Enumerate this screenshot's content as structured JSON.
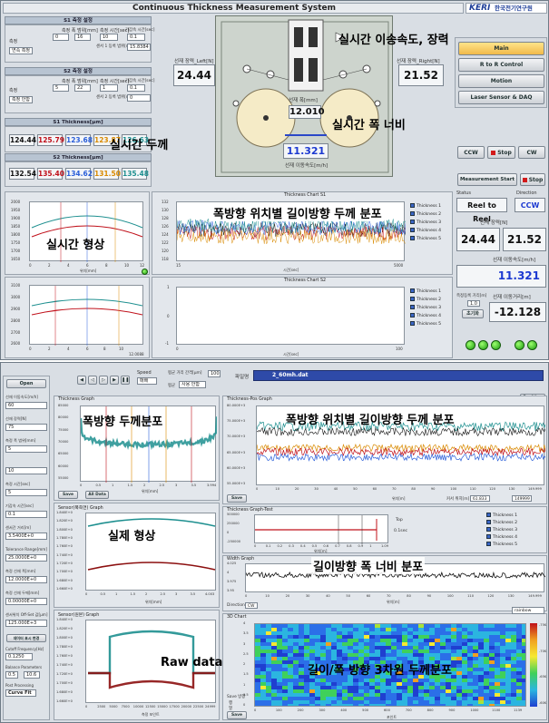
{
  "top": {
    "window_title": "Continuous Thickness Measurement System",
    "logo_brand": "KERI",
    "logo_org": "한국전기연구원",
    "s1_header": "S1 측정 설정",
    "s2_header": "S2 측정 설정",
    "s1_measure_label": "측정",
    "s1_mode": "연속 측정",
    "s1_width_label": "측정 폭 범위[mm]",
    "s1_width_from": "0",
    "s1_width_to": "16",
    "s1_time_label": "측정 시간[sec]",
    "s1_time": "10",
    "s1_wait_label": "기갑속 시간[sec]",
    "s1_wait": "0.1",
    "s1_sensor_label": "센서 1 등록 범위[m]",
    "s1_sensor_value": "15.8384",
    "s2_measure_label": "측정",
    "s2_mode": "측정 안함",
    "s2_width_label": "측정 폭 범위[mm]",
    "s2_width_from": "5",
    "s2_width_to": "22",
    "s2_time_label": "측정 시간[sec]",
    "s2_time": "1",
    "s2_wait_label": "기갑속 시간[sec]",
    "s2_wait": "0.1",
    "s2_sensor_label": "센서 2 등록 범위[m]",
    "s2_sensor_value": "0",
    "s1_thickness_header": "S1 Thickness[μm]",
    "s2_thickness_header": "S2 Thickness[μm]",
    "s1_thickness": [
      "124.44",
      "125.79",
      "123.68",
      "123.87",
      "126.63"
    ],
    "s2_thickness": [
      "132.54",
      "135.40",
      "134.62",
      "131.50",
      "135.48"
    ],
    "thickness_colors": [
      "#111111",
      "#c0101a",
      "#2b5fd9",
      "#d98a00",
      "#1d8f8f"
    ],
    "tension_left_label": "선재 장력_Left[N]",
    "tension_left": "24.44",
    "tension_right_label": "선재 장력_Right[N]",
    "tension_right": "21.52",
    "width_label": "선재 폭[mm]",
    "width_value": "12.010",
    "speed_label": "선재 이동속도[m/h]",
    "speed_value": "11.321",
    "ann_speed_tension": "실시간 이송속도, 장력",
    "ann_width": "실시간 폭 너비",
    "ann_thickness": "실시간 두께",
    "ann_shape": "실시간 형상",
    "ann_dist": "폭방향 위치별 길이방향 두께 분포",
    "menu": [
      "Main",
      "R to R Control",
      "Motion",
      "Laser Sensor & DAQ"
    ],
    "ccw_label": "CCW",
    "stop_label": "Stop",
    "cw_label": "CW",
    "measure_start": "Measurement Start",
    "stop2_label": "Stop",
    "status_label": "Status",
    "status_value": "Reel to Reel",
    "direction_label": "Direction",
    "direction_value": "CCW",
    "tension_side_label": "선재 장력[N]",
    "tension_side_left": "24.44",
    "tension_side_right": "21.52",
    "speed_side_label": "선재 이동속도[m/h]",
    "speed_side_value": "11.321",
    "distance_side_label": "선재 이동거리[m]",
    "distance_side_value": "-12.128",
    "dist_interval_label": "측정등록 거리[m]",
    "dist_interval_value": "1.0",
    "reset_label": "초기화",
    "chart_left1_title": "Thickness Chart S1",
    "chart_left2_title": "Thickness Chart S2",
    "chart_left1_xlabel": "위치[mm]",
    "chart_s1_xlabel": "시간[sec]",
    "chart_s2_xlabel": "시간[sec]",
    "legend": [
      "Thickness 1",
      "Thickness 2",
      "Thickness 3",
      "Thickness 4",
      "Thickness 5"
    ],
    "left1_yticks": [
      "2000",
      "1950",
      "1900",
      "1850",
      "1800",
      "1750",
      "1700",
      "1650"
    ],
    "left1_xticks": [
      "0",
      "2",
      "4",
      "6",
      "8",
      "10",
      "12"
    ],
    "left2_yticks": [
      "3100",
      "3000",
      "2900",
      "2800",
      "2700",
      "2600"
    ],
    "left2_xticks": [
      "0",
      "2",
      "4",
      "6",
      "8",
      "10",
      "12.0088"
    ],
    "s1_yticks": [
      "132",
      "130",
      "128",
      "126",
      "124",
      "122",
      "120",
      "118"
    ],
    "s1_xticks": [
      "15",
      "5000"
    ],
    "s2_yticks": [
      "1",
      "0",
      "-1"
    ],
    "s2_xticks": [
      "0",
      "100"
    ],
    "s2_xticks_mid": "0"
  },
  "bottom": {
    "open_btn": "Open",
    "speed_label": "Speed",
    "speed_value": "매배",
    "avg_dist_label": "평균 거리 간격[μm]",
    "avg_dist_value": "100",
    "avg_label": "평균",
    "avg_value": "사용 안함",
    "filename_label": "파일명",
    "filename_value": "2_60mh.dat",
    "position_btn": "Position",
    "left_fields": [
      {
        "label": "선재 이동속도[m/h]",
        "value": "60"
      },
      {
        "label": "선재 장력[N]",
        "value": "75"
      },
      {
        "label": "측정 폭 범위[mm]",
        "value": "5"
      },
      {
        "label": "",
        "value": "10"
      },
      {
        "label": "측정 시간[sec]",
        "value": "5"
      },
      {
        "label": "기갑속 시간[sec]",
        "value": "0.1"
      },
      {
        "label": "센서간 거리[m]",
        "value": "3.5400E+0"
      },
      {
        "label": "Tolerance Range[mm]",
        "value": "25.0000E+0"
      },
      {
        "label": "측정 선재 폭[mm]",
        "value": "12.0000E+0"
      },
      {
        "label": "측정 선재 두께[mm]",
        "value": "0.00000E+0"
      },
      {
        "label": "센서위치 Off-Set 값[μm]",
        "value": "125.000E+3"
      }
    ],
    "view_more": "데이터 표시 변경",
    "cutoff_label": "Cutoff Frequency[Hz]",
    "cutoff_value": "0.1250",
    "balance_label": "Balance Parameters",
    "balance_a": "0.5",
    "balance_b": "10.6",
    "post_label": "Post Processing",
    "post_value": "Curve Fit",
    "thickness_graph_title": "Thickness Graph",
    "thickness_graph_yticks": [
      "85000",
      "80000",
      "75000",
      "70000",
      "65000",
      "60000",
      "55000"
    ],
    "thickness_graph_xticks": [
      "0",
      "0.5",
      "1",
      "1.5",
      "2",
      "2.5",
      "3",
      "3.5",
      "3.994"
    ],
    "thickness_graph_xlabel": "위치[mm]",
    "save_label": "Save",
    "all_data_label": "All Data",
    "sensor_s_title": "Sensor(폭측면) Graph",
    "sensor_s_yticks": [
      "1.840E+0",
      "1.820E+0",
      "1.800E+0",
      "1.780E+0",
      "1.760E+0",
      "1.740E+0",
      "1.720E+0",
      "1.700E+0",
      "1.680E+0",
      "1.660E+0"
    ],
    "sensor_s_xticks": [
      "0",
      "0.5",
      "1",
      "1.5",
      "2",
      "2.5",
      "3",
      "3.5",
      "4.003"
    ],
    "sensor_s_xlabel": "위치[mm]",
    "sensor_r_title": "Sensor(원본) Graph",
    "sensor_r_yticks": [
      "1.840E+0",
      "1.820E+0",
      "1.800E+0",
      "1.780E+0",
      "1.760E+0",
      "1.740E+0",
      "1.720E+0",
      "1.700E+0",
      "1.680E+0",
      "1.660E+0"
    ],
    "sensor_r_xticks": [
      "0",
      "2500",
      "5000",
      "7500",
      "10000",
      "12500",
      "15000",
      "17500",
      "20000",
      "22500",
      "24999"
    ],
    "sensor_r_xlabel": "측정 포인트",
    "ann_width_dist": "폭방향 두께분포",
    "ann_shape": "실제 형상",
    "ann_raw": "Raw data",
    "ann_len_dist": "폭방향 위치별 길이방향 두께 분포",
    "ann_len_width": "길이방향 폭 너비 분포",
    "ann_3d": "길이/폭 방향 3차원 두께분포",
    "tp_graph_title": "Thickness-Pos Graph",
    "tp_yticks": [
      "80.000E+3",
      "75.000E+3",
      "70.000E+3",
      "65.000E+3",
      "60.000E+3",
      "55.000E+3"
    ],
    "tp_xticks": [
      "0",
      "10",
      "20",
      "30",
      "40",
      "50",
      "60",
      "70",
      "80",
      "90",
      "100",
      "110",
      "120",
      "130",
      "149.999"
    ],
    "tp_xlabel": "위치[m]",
    "cursor_label": "커서 위치[m]",
    "cursor_value": "61.833",
    "end_value": "149999",
    "test_graph_title": "Thickness Graph-Test",
    "test_yticks": [
      "500000",
      "250000",
      "0",
      "-250000"
    ],
    "test_xticks": [
      "0",
      "0.1",
      "0.2",
      "0.3",
      "0.4",
      "0.5",
      "0.6",
      "0.7",
      "0.8",
      "0.9",
      "1",
      "1.09"
    ],
    "test_xlabel": "위치[m]",
    "top_label": "Top",
    "tmax_label": "0.1sec",
    "width_graph_title": "Width Graph",
    "width_yticks": [
      "4.025",
      "4",
      "3.975",
      "3.95"
    ],
    "width_xticks": [
      "0",
      "10",
      "20",
      "30",
      "40",
      "50",
      "60",
      "70",
      "80",
      "90",
      "100",
      "110",
      "120",
      "130",
      "149.999"
    ],
    "width_xlabel": "위치[m]",
    "direction_label": "Direction",
    "direction_value": "CW",
    "chart3d_title": "3D Chart",
    "colormap": "rainbow",
    "chart3d_yticks": [
      "4",
      "3.5",
      "3",
      "2.5",
      "2",
      "1.5",
      "1",
      "0.5",
      "0"
    ],
    "chart3d_xticks": [
      "0",
      "100",
      "200",
      "300",
      "400",
      "500",
      "600",
      "700",
      "800",
      "900",
      "1000",
      "1100",
      "1139"
    ],
    "chart3d_xlabel": "포인트",
    "colorbar_labels": [
      "-75K",
      "-70K",
      "-65K",
      "-60K"
    ],
    "save_opt_label": "Save 방향",
    "save_opt_1": "행",
    "save_opt_2": "열",
    "legend": [
      "Thickness 1",
      "Thickness 2",
      "Thickness 3",
      "Thickness 4",
      "Thickness 5"
    ]
  }
}
